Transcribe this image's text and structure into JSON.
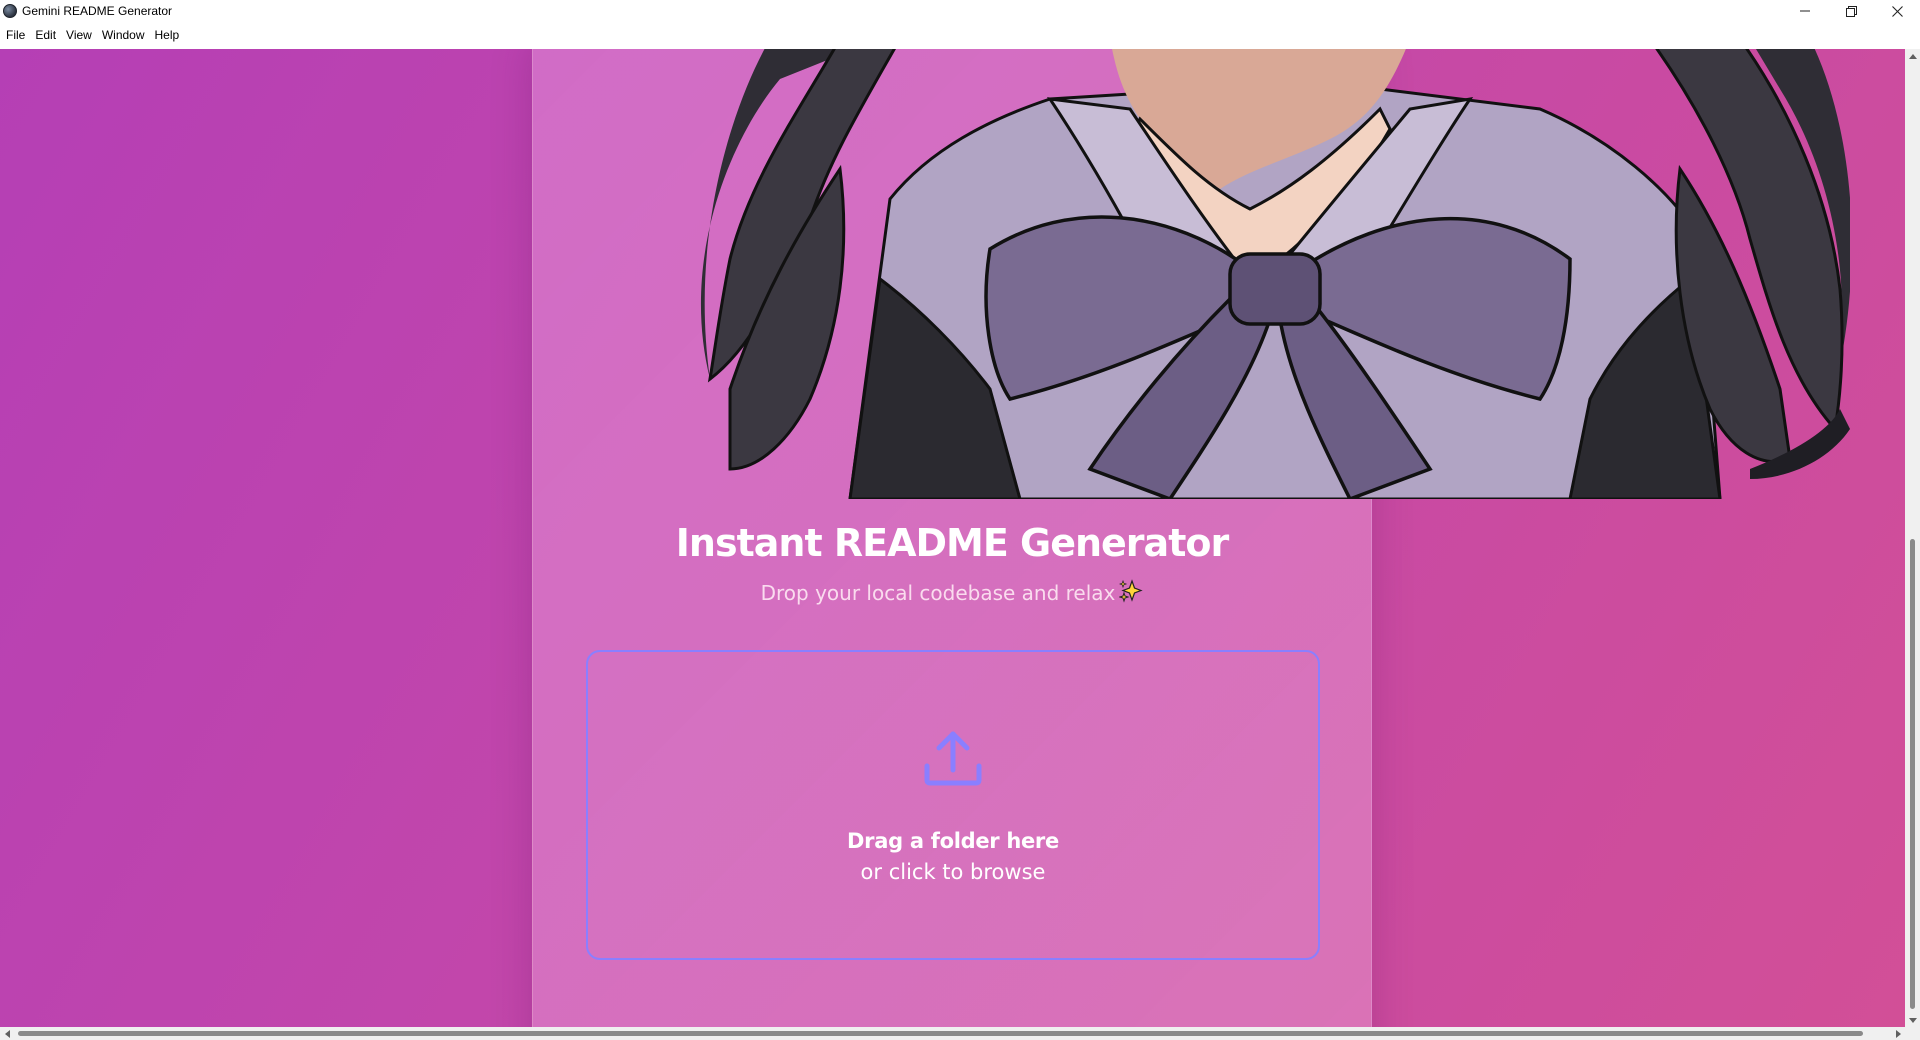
{
  "window": {
    "title": "Gemini README Generator",
    "icon": "app-icon"
  },
  "menu": {
    "items": [
      "File",
      "Edit",
      "View",
      "Window",
      "Help"
    ]
  },
  "colors": {
    "background_start": "#b53fb5",
    "background_end": "#d24f97",
    "dropzone_border": "#8a7fff",
    "title_text": "#ffffff"
  },
  "hero": {
    "image": "anime-character-illustration"
  },
  "main": {
    "title": "Instant README Generator",
    "subtitle": "Drop your local codebase and relax",
    "subtitle_icon": "sparkles-icon"
  },
  "dropzone": {
    "icon": "upload-icon",
    "primary_text": "Drag a folder here",
    "secondary_text": "or click to browse"
  }
}
